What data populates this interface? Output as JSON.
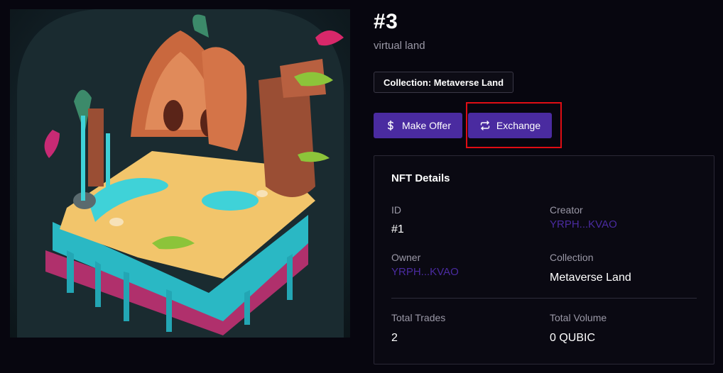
{
  "nft": {
    "title": "#3",
    "subtitle": "virtual land",
    "collection_badge": "Collection: Metaverse Land",
    "artwork_icon": "floating-island-artwork"
  },
  "actions": {
    "make_offer_label": "Make Offer",
    "make_offer_icon": "dollar-icon",
    "exchange_label": "Exchange",
    "exchange_icon": "exchange-arrows-icon"
  },
  "details": {
    "heading": "NFT Details",
    "id_label": "ID",
    "id_value": "#1",
    "creator_label": "Creator",
    "creator_value": "YRPH...KVAO",
    "owner_label": "Owner",
    "owner_value": "YRPH...KVAO",
    "collection_label": "Collection",
    "collection_value": "Metaverse Land",
    "trades_label": "Total Trades",
    "trades_value": "2",
    "volume_label": "Total Volume",
    "volume_value": "0 QUBIC"
  },
  "colors": {
    "accent": "#4a2ba0",
    "background": "#07060f",
    "highlight": "#e00d14",
    "muted_text": "#9a98a6"
  }
}
